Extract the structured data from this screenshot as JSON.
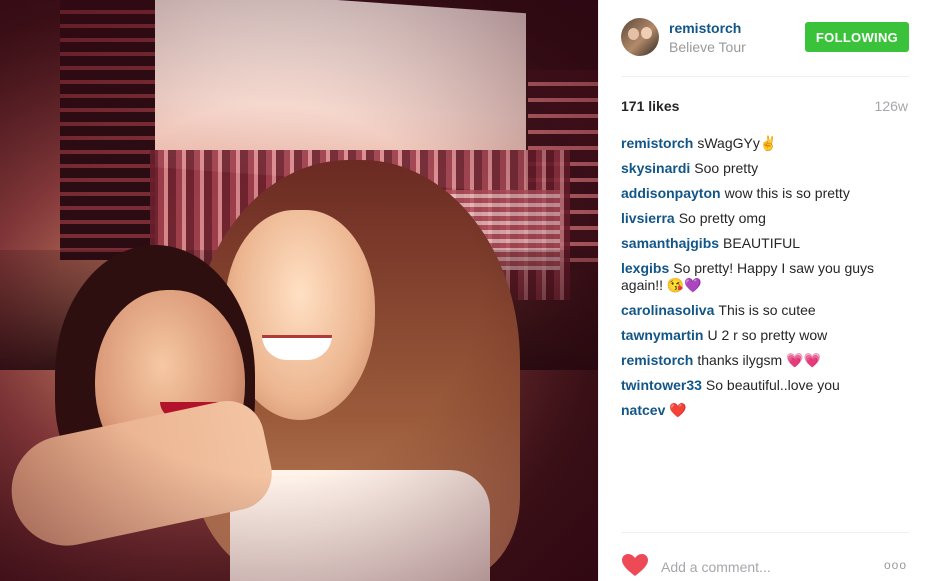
{
  "post": {
    "photo_alt": "Two girls posing at a concert",
    "header": {
      "username": "remistorch",
      "location": "Believe Tour",
      "follow_label": "FOLLOWING"
    },
    "likes": "171 likes",
    "age": "126w",
    "comments": [
      {
        "user": "remistorch",
        "text": "sWagGYy✌"
      },
      {
        "user": "skysinardi",
        "text": "Soo pretty"
      },
      {
        "user": "addisonpayton",
        "text": "wow this is so pretty"
      },
      {
        "user": "livsierra",
        "text": "So pretty omg"
      },
      {
        "user": "samanthajgibs",
        "text": "BEAUTIFUL"
      },
      {
        "user": "lexgibs",
        "text": "So pretty! Happy I saw you guys again!! 😘💜"
      },
      {
        "user": "carolinasoliva",
        "text": "This is so cutee"
      },
      {
        "user": "tawnymartin",
        "text": "U 2 r so pretty wow"
      },
      {
        "user": "remistorch",
        "text": "thanks ilygsm 💗💗"
      },
      {
        "user": "twintower33",
        "text": "So beautiful..love you"
      },
      {
        "user": "natcev",
        "text": "❤️"
      }
    ],
    "comment_input": {
      "placeholder": "Add a comment..."
    },
    "more_label": "ooo",
    "colors": {
      "link": "#125688",
      "follow_button": "#3ac33a",
      "heart": "#ed4956"
    },
    "icons": {
      "like": "heart-icon",
      "more": "ellipsis-icon"
    }
  }
}
